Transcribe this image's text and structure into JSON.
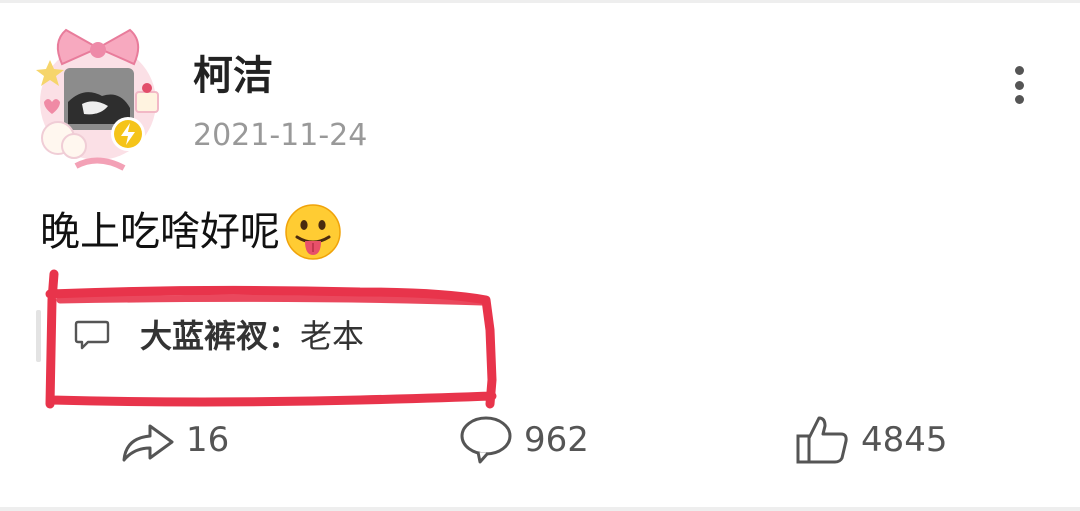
{
  "post": {
    "author": "柯洁",
    "date": "2021-11-24",
    "text": "晚上吃啥好呢",
    "emoji_icon": "tongue-out-emoji"
  },
  "comment_preview": {
    "commenter": "大蓝裤衩：",
    "text": "老本"
  },
  "actions": {
    "share_count": "16",
    "comment_count": "962",
    "like_count": "4845"
  },
  "icons": {
    "more": "vertical-ellipsis-icon",
    "share": "share-arrow-icon",
    "comment": "comment-bubble-icon",
    "like": "thumbs-up-icon",
    "verified": "lightning-badge-icon"
  },
  "colors": {
    "annotation": "#e8344b",
    "verified_badge": "#f5c419",
    "date": "#999999"
  }
}
